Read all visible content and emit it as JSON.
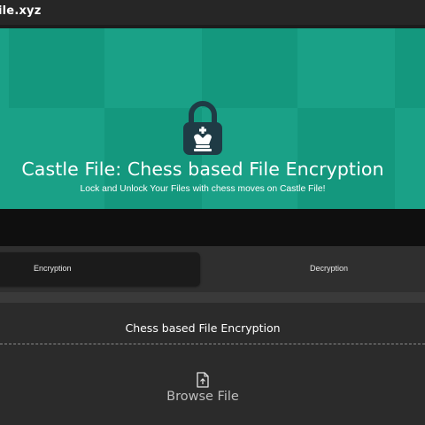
{
  "header": {
    "brand": "ile.xyz"
  },
  "hero": {
    "title": "Castle File: Chess based File Encryption",
    "subtitle": "Lock and Unlock Your Files with chess moves on Castle File!",
    "logo_icon": "lock-with-chess-king-icon"
  },
  "tabs": {
    "encryption_label": "Encryption",
    "decryption_label": "Decryption",
    "active": "Encryption"
  },
  "panel": {
    "title": "Chess based File Encryption",
    "browse_label": "Browse File",
    "browse_icon": "file-upload-icon"
  },
  "colors": {
    "hero_light": "#1aa187",
    "hero_dark": "#14987e",
    "lock_body": "#1f3b45",
    "page_bg": "#3a3a3a",
    "panel_bg": "#2b2b2b"
  }
}
